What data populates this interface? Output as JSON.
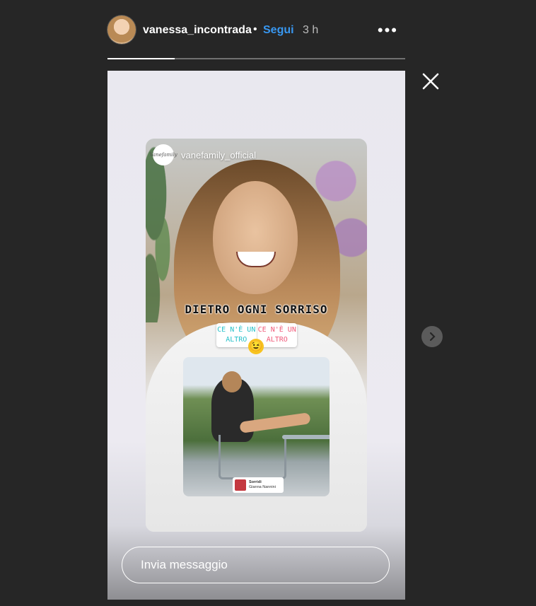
{
  "header": {
    "username": "vanessa_incontrada",
    "separator": "•",
    "follow_label": "Segui",
    "time": "3 h",
    "more_icon": "more-horizontal-icon"
  },
  "progress": {
    "value": 0.225
  },
  "story": {
    "repost": {
      "owner_name": "vanefamily_official",
      "owner_logo_text": "Vanefamily",
      "headline": "DIETRO OGNI SORRISO",
      "poll": {
        "option_a_line1": "CE N'È UN",
        "option_a_line2": "ALTRO",
        "option_b_line1": "CE N'È UN",
        "option_b_line2": "ALTRO",
        "emoji": "😉"
      },
      "music": {
        "title": "Sorridi",
        "artist": "Gianna Nannini"
      }
    }
  },
  "reply": {
    "placeholder": "Invia messaggio"
  },
  "colors": {
    "background": "#262626",
    "follow": "#3897f0"
  }
}
